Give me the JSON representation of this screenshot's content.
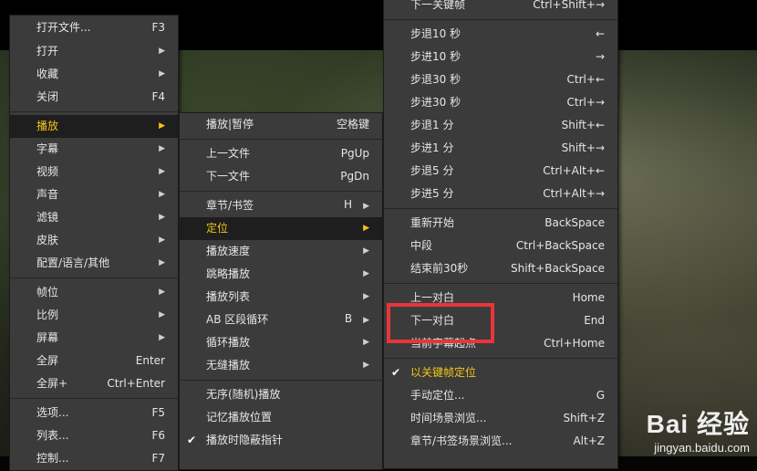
{
  "menu_main": {
    "items": [
      {
        "label": "打开文件...",
        "shortcut": "F3"
      },
      {
        "label": "打开",
        "arrow": "▶"
      },
      {
        "label": "收藏",
        "arrow": "▶"
      },
      {
        "label": "关闭",
        "shortcut": "F4"
      },
      {
        "label": "播放",
        "arrow": "▶"
      },
      {
        "label": "字幕",
        "arrow": "▶"
      },
      {
        "label": "视频",
        "arrow": "▶"
      },
      {
        "label": "声音",
        "arrow": "▶"
      },
      {
        "label": "滤镜",
        "arrow": "▶"
      },
      {
        "label": "皮肤",
        "arrow": "▶"
      },
      {
        "label": "配置/语言/其他",
        "arrow": "▶"
      },
      {
        "label": "帧位",
        "arrow": "▶"
      },
      {
        "label": "比例",
        "arrow": "▶"
      },
      {
        "label": "屏幕",
        "arrow": "▶"
      },
      {
        "label": "全屏",
        "shortcut": "Enter"
      },
      {
        "label": "全屏+",
        "shortcut": "Ctrl+Enter"
      },
      {
        "label": "选项...",
        "shortcut": "F5"
      },
      {
        "label": "列表...",
        "shortcut": "F6"
      },
      {
        "label": "控制...",
        "shortcut": "F7"
      }
    ]
  },
  "menu_play": {
    "items": [
      {
        "label": "播放|暂停",
        "shortcut": "空格键"
      },
      {
        "label": "上一文件",
        "shortcut": "PgUp"
      },
      {
        "label": "下一文件",
        "shortcut": "PgDn"
      },
      {
        "label": "章节/书签",
        "shortcut": "H",
        "arrow": "▶"
      },
      {
        "label": "定位",
        "arrow": "▶"
      },
      {
        "label": "播放速度",
        "arrow": "▶"
      },
      {
        "label": "跳略播放",
        "arrow": "▶"
      },
      {
        "label": "播放列表",
        "arrow": "▶"
      },
      {
        "label": "AB 区段循环",
        "shortcut": "B",
        "arrow": "▶"
      },
      {
        "label": "循环播放",
        "arrow": "▶"
      },
      {
        "label": "无缝播放",
        "arrow": "▶"
      },
      {
        "label": "无序(随机)播放"
      },
      {
        "label": "记忆播放位置"
      },
      {
        "label": "播放时隐蔽指针",
        "checked": "✔"
      }
    ]
  },
  "menu_seek": {
    "items": [
      {
        "label": "下一关键帧",
        "shortcut": "Ctrl+Shift+→"
      },
      {
        "label": "步退10 秒",
        "shortcut": "←"
      },
      {
        "label": "步进10 秒",
        "shortcut": "→"
      },
      {
        "label": "步退30 秒",
        "shortcut": "Ctrl+←"
      },
      {
        "label": "步进30 秒",
        "shortcut": "Ctrl+→"
      },
      {
        "label": "步退1 分",
        "shortcut": "Shift+←"
      },
      {
        "label": "步进1 分",
        "shortcut": "Shift+→"
      },
      {
        "label": "步退5 分",
        "shortcut": "Ctrl+Alt+←"
      },
      {
        "label": "步进5 分",
        "shortcut": "Ctrl+Alt+→"
      },
      {
        "label": "重新开始",
        "shortcut": "BackSpace"
      },
      {
        "label": "中段",
        "shortcut": "Ctrl+BackSpace"
      },
      {
        "label": "结束前30秒",
        "shortcut": "Shift+BackSpace"
      },
      {
        "label": "上一对白",
        "shortcut": "Home"
      },
      {
        "label": "下一对白",
        "shortcut": "End"
      },
      {
        "label": "当前字幕起点",
        "shortcut": "Ctrl+Home"
      },
      {
        "label": "以关键帧定位",
        "checked": "✔"
      },
      {
        "label": "手动定位...",
        "shortcut": "G"
      },
      {
        "label": "时间场景浏览...",
        "shortcut": "Shift+Z"
      },
      {
        "label": "章节/书签场景浏览...",
        "shortcut": "Alt+Z"
      }
    ]
  },
  "watermark": {
    "brand": "Bai 经验",
    "url": "jingyan.baidu.com"
  },
  "colors": {
    "menu_bg": "#3b3b3b",
    "active_text": "#f5c518",
    "highlight_border": "#e8353a"
  }
}
